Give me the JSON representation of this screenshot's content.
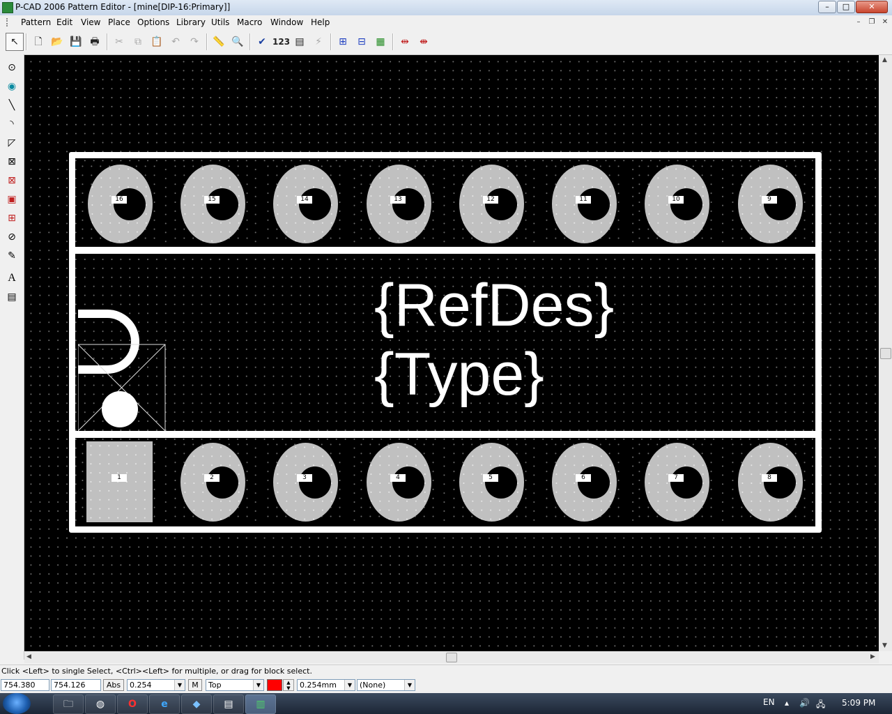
{
  "window": {
    "title": "P-CAD 2006 Pattern Editor - [mine[DIP-16:Primary]]",
    "controls": {
      "minimize": "–",
      "maximize": "□",
      "close": "✕"
    }
  },
  "menubar": {
    "items": [
      "Pattern",
      "Edit",
      "View",
      "Place",
      "Options",
      "Library",
      "Utils",
      "Macro",
      "Window",
      "Help"
    ],
    "mdi_controls": {
      "minimize": "–",
      "restore": "❐",
      "close": "✕"
    }
  },
  "toolbar": {
    "buttons": [
      {
        "name": "select-tool",
        "glyph": "↖"
      },
      {
        "name": "new-file",
        "glyph": "🗋"
      },
      {
        "name": "open-file",
        "glyph": "📂"
      },
      {
        "name": "save-file",
        "glyph": "💾"
      },
      {
        "name": "print",
        "glyph": "🖶"
      },
      {
        "name": "cut",
        "glyph": "✂"
      },
      {
        "name": "copy",
        "glyph": "⧉"
      },
      {
        "name": "paste",
        "glyph": "📋"
      },
      {
        "name": "undo",
        "glyph": "↶"
      },
      {
        "name": "redo",
        "glyph": "↷"
      },
      {
        "name": "measure",
        "glyph": "📏"
      },
      {
        "name": "zoom",
        "glyph": "🔍"
      },
      {
        "name": "design-rule-check",
        "glyph": "✔"
      },
      {
        "name": "renumber",
        "glyph": "123"
      },
      {
        "name": "pattern-properties",
        "glyph": "▤"
      },
      {
        "name": "flash",
        "glyph": "⚡"
      },
      {
        "name": "select-points",
        "glyph": "⊞"
      },
      {
        "name": "select-pads",
        "glyph": "⊟"
      },
      {
        "name": "select-color",
        "glyph": "▦"
      },
      {
        "name": "align-horizontal",
        "glyph": "⇹"
      },
      {
        "name": "align-vertical",
        "glyph": "⇼"
      }
    ]
  },
  "palette": {
    "tools": [
      {
        "name": "place-pad",
        "glyph": "⊙"
      },
      {
        "name": "place-via",
        "glyph": "◉"
      },
      {
        "name": "place-line",
        "glyph": "╲"
      },
      {
        "name": "place-arc",
        "glyph": "◝"
      },
      {
        "name": "place-polygon",
        "glyph": "◸"
      },
      {
        "name": "place-keepout",
        "glyph": "⊠"
      },
      {
        "name": "place-fill",
        "glyph": "⊠"
      },
      {
        "name": "place-copper-pour",
        "glyph": "▣"
      },
      {
        "name": "place-cutout",
        "glyph": "⊞"
      },
      {
        "name": "place-plane",
        "glyph": "⊘"
      },
      {
        "name": "place-attribute",
        "glyph": "✎"
      },
      {
        "name": "place-text",
        "glyph": "A"
      },
      {
        "name": "place-field",
        "glyph": "▤"
      }
    ]
  },
  "canvas": {
    "top_pins": [
      "16",
      "15",
      "14",
      "13",
      "12",
      "11",
      "10",
      "9"
    ],
    "bottom_pins": [
      "1",
      "2",
      "3",
      "4",
      "5",
      "6",
      "7",
      "8"
    ],
    "refdes_attr": "{RefDes}",
    "type_attr": "{Type}",
    "colors": {
      "background": "#000000",
      "outline": "#ffffff",
      "pad": "#c0c0c0"
    }
  },
  "status": {
    "message": "Click <Left> to single Select, <Ctrl><Left> for multiple, or drag for block select.",
    "x_coord": "754.380",
    "y_coord": "754.126",
    "abs_label": "Abs",
    "grid": "0.254",
    "m_label": "M",
    "layer": "Top",
    "layer_color": "#ff0000",
    "line_width": "0.254mm",
    "net": "(None)"
  },
  "taskbar": {
    "apps": [
      {
        "name": "file-explorer",
        "glyph": "🗀"
      },
      {
        "name": "chrome",
        "glyph": "◍"
      },
      {
        "name": "opera",
        "glyph": "O"
      },
      {
        "name": "edge",
        "glyph": "e"
      },
      {
        "name": "app-blue",
        "glyph": "◆"
      },
      {
        "name": "app-doc",
        "glyph": "▤"
      },
      {
        "name": "pcad",
        "glyph": "▥"
      }
    ],
    "language": "EN",
    "clock": "5:09 PM"
  }
}
